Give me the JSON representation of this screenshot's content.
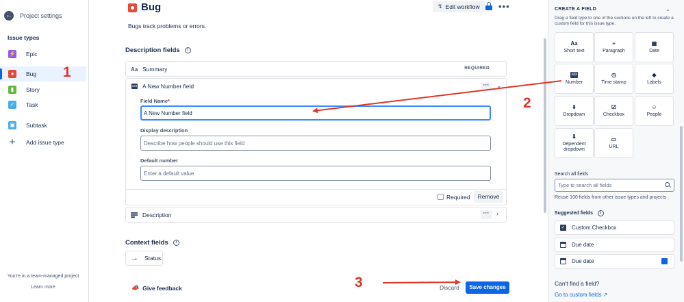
{
  "sidebar": {
    "back_label": "Project settings",
    "heading": "Issue types",
    "items": [
      {
        "label": "Epic",
        "color": "#8f5af7",
        "icon": "lightning-icon"
      },
      {
        "label": "Bug",
        "color": "#e5493a",
        "icon": "bug-icon"
      },
      {
        "label": "Story",
        "color": "#63ba3c",
        "icon": "bookmark-icon"
      },
      {
        "label": "Task",
        "color": "#4bade8",
        "icon": "check-icon"
      },
      {
        "label": "Subtask",
        "color": "#4bade8",
        "icon": "subtask-icon"
      },
      {
        "label": "Add issue type",
        "icon": "plus-icon"
      }
    ],
    "footer_text": "You're in a team-managed project",
    "learn_more": "Learn more"
  },
  "header": {
    "title": "Bug",
    "edit_workflow": "Edit workflow",
    "description": "Bugs track problems or errors."
  },
  "description_fields": {
    "title": "Description fields",
    "summary": {
      "label": "Summary",
      "tag": "REQUIRED",
      "icon_text": "Aa"
    },
    "new_field": {
      "label": "A New Number field",
      "icon_text": "123",
      "field_name_label": "Field Name",
      "field_name_value": "A New Number field",
      "display_description_label": "Display description",
      "display_description_placeholder": "Describe how people should use this field",
      "default_number_label": "Default number",
      "default_number_placeholder": "Enter a default value",
      "required_label": "Required",
      "remove_label": "Remove"
    },
    "description": {
      "label": "Description"
    }
  },
  "context_fields": {
    "title": "Context fields",
    "status": {
      "label": "Status"
    }
  },
  "footer": {
    "feedback": "Give feedback",
    "discard": "Discard",
    "save": "Save changes"
  },
  "create_panel": {
    "title": "CREATE A FIELD",
    "description": "Drag a field type to one of the sections on the left to create a custom field for this issue type.",
    "tiles": [
      {
        "label": "Short text",
        "icon": "Aa"
      },
      {
        "label": "Paragraph",
        "icon": "≡"
      },
      {
        "label": "Date",
        "icon": "▦"
      },
      {
        "label": "Number",
        "icon": "123"
      },
      {
        "label": "Time stamp",
        "icon": "◷"
      },
      {
        "label": "Labels",
        "icon": "◆"
      },
      {
        "label": "Dropdown",
        "icon": "⬇"
      },
      {
        "label": "Checkbox",
        "icon": "☑"
      },
      {
        "label": "People",
        "icon": "☺"
      },
      {
        "label": "Dependent dropdown",
        "icon": "⬇"
      },
      {
        "label": "URL",
        "icon": "▭"
      }
    ],
    "search_label": "Search all fields",
    "search_placeholder": "Type to search all fields",
    "reuse_text": "Reuse 100 fields from other issue types and projects",
    "suggested_label": "Suggested fields",
    "suggested": [
      {
        "label": "Custom Checkbox"
      },
      {
        "label": "Due date"
      },
      {
        "label": "Due date"
      }
    ],
    "cant_find": "Can't find a field?",
    "go_to_custom": "Go to custom fields"
  },
  "annotations": {
    "one": "1",
    "two": "2",
    "three": "3",
    "color": "#e0352b"
  }
}
